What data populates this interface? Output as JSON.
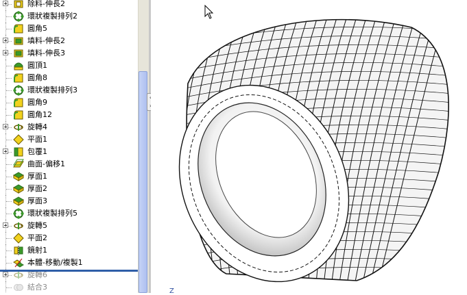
{
  "feature_tree": {
    "items": [
      {
        "label": "除料-伸長2",
        "icon": "cut-extrude-icon",
        "expandable": true,
        "disabled": false
      },
      {
        "label": "環狀複製排列2",
        "icon": "circular-pattern-icon",
        "expandable": false,
        "disabled": false
      },
      {
        "label": "圓角5",
        "icon": "fillet-icon",
        "expandable": false,
        "disabled": false
      },
      {
        "label": "填料-伸長2",
        "icon": "boss-extrude-icon",
        "expandable": true,
        "disabled": false
      },
      {
        "label": "填料-伸長3",
        "icon": "boss-extrude-icon",
        "expandable": true,
        "disabled": false
      },
      {
        "label": "圓頂1",
        "icon": "dome-icon",
        "expandable": false,
        "disabled": false
      },
      {
        "label": "圓角8",
        "icon": "fillet-icon",
        "expandable": false,
        "disabled": false
      },
      {
        "label": "環狀複製排列3",
        "icon": "circular-pattern-icon",
        "expandable": false,
        "disabled": false
      },
      {
        "label": "圓角9",
        "icon": "fillet-icon",
        "expandable": false,
        "disabled": false
      },
      {
        "label": "圓角12",
        "icon": "fillet-icon",
        "expandable": false,
        "disabled": false
      },
      {
        "label": "旋轉4",
        "icon": "revolve-icon",
        "expandable": true,
        "disabled": false
      },
      {
        "label": "平面1",
        "icon": "plane-icon",
        "expandable": false,
        "disabled": false
      },
      {
        "label": "包覆1",
        "icon": "wrap-icon",
        "expandable": true,
        "disabled": false
      },
      {
        "label": "曲面-偏移1",
        "icon": "offset-surface-icon",
        "expandable": false,
        "disabled": false
      },
      {
        "label": "厚面1",
        "icon": "thicken-icon",
        "expandable": false,
        "disabled": false
      },
      {
        "label": "厚面2",
        "icon": "thicken-icon",
        "expandable": false,
        "disabled": false
      },
      {
        "label": "厚面3",
        "icon": "thicken-icon",
        "expandable": false,
        "disabled": false
      },
      {
        "label": "環狀複製排列5",
        "icon": "circular-pattern-icon",
        "expandable": false,
        "disabled": false
      },
      {
        "label": "旋轉5",
        "icon": "revolve-icon",
        "expandable": true,
        "disabled": false
      },
      {
        "label": "平面2",
        "icon": "plane-icon",
        "expandable": false,
        "disabled": false
      },
      {
        "label": "鏡射1",
        "icon": "mirror-icon",
        "expandable": false,
        "disabled": false
      },
      {
        "label": "本體-移動/複製1",
        "icon": "move-copy-body-icon",
        "expandable": false,
        "disabled": false
      },
      {
        "label": "旋轉6",
        "icon": "revolve-icon",
        "expandable": true,
        "disabled": true
      },
      {
        "label": "結合3",
        "icon": "combine-icon",
        "expandable": false,
        "disabled": true
      }
    ]
  },
  "viewport": {
    "model_icon": "tire-model",
    "cursor_icon": "arrow-cursor-icon",
    "axis_label": "Z"
  },
  "colors": {
    "rollback_bar": "#2f5ea8",
    "icon_yellow": "#f2d21e",
    "icon_green": "#3b9a2a",
    "scroll_thumb": "#b9c8f3"
  }
}
